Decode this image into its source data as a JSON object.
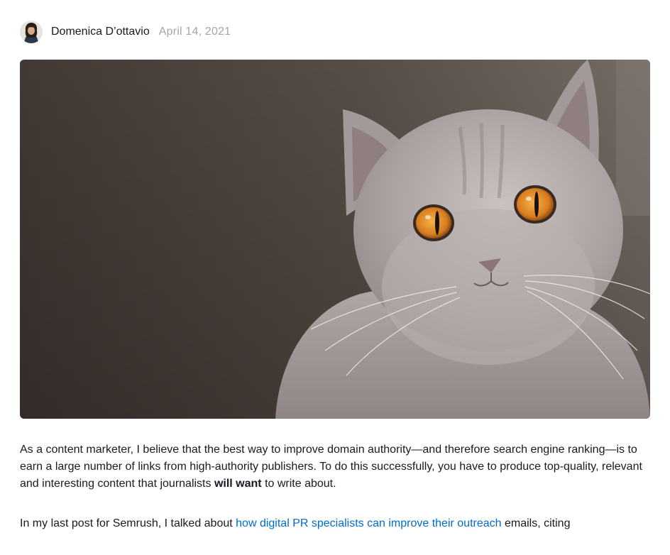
{
  "post": {
    "author": {
      "name": "Domenica D’ottavio",
      "avatar_icon": "author-avatar-photo"
    },
    "date": "April 14, 2021",
    "hero_image": {
      "subject": "grey cat with orange eyes",
      "colors": {
        "background_dark": "#3a322e",
        "background_light": "#6a6058",
        "fur": "#b5acaa",
        "eye": "#e08a2a"
      }
    },
    "paragraphs": [
      {
        "before": "As a content marketer, I believe that the best way to improve domain authority—and therefore search engine ranking—is to earn a large number of links from high-authority publishers. To do this successfully, you have to produce top-quality, relevant and interesting content that journalists ",
        "bold": "will want",
        "after": " to write about."
      },
      {
        "before": "In my last post for Semrush, I talked about ",
        "link_text": "how digital PR specialists can improve their outreach",
        "after": " emails, citing"
      }
    ],
    "link_color": "#006dca"
  }
}
